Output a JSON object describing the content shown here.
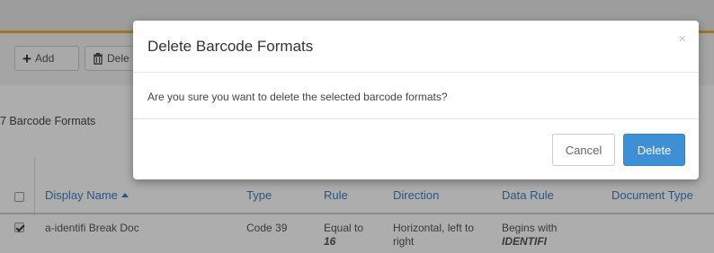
{
  "toolbar": {
    "add_label": "Add",
    "delete_label": "Dele"
  },
  "list": {
    "count_label": "7 Barcode Formats"
  },
  "table": {
    "headers": {
      "display_name": "Display Name",
      "type_partial": "Type",
      "rule_partial": "Rule",
      "direction": "Direction",
      "data_rule": "Data Rule",
      "document_type": "Document Type"
    },
    "rows": [
      {
        "checked": true,
        "display_name": "a-identifi Break Doc",
        "type": "Code 39",
        "length_rule": "Equal to",
        "length_value": "16",
        "direction_line1": "Horizontal, left to",
        "direction_line2": "right",
        "data_rule_line1": "Begins with",
        "data_rule_value": "IDENTIFI",
        "document_type": ""
      }
    ]
  },
  "modal": {
    "title": "Delete Barcode Formats",
    "close_symbol": "×",
    "message": "Are you sure you want to delete the selected barcode formats?",
    "cancel_label": "Cancel",
    "delete_label": "Delete"
  },
  "colors": {
    "accent_line": "#e8b23a",
    "link_blue": "#3f7fc0",
    "primary_button": "#3d8fd6"
  }
}
